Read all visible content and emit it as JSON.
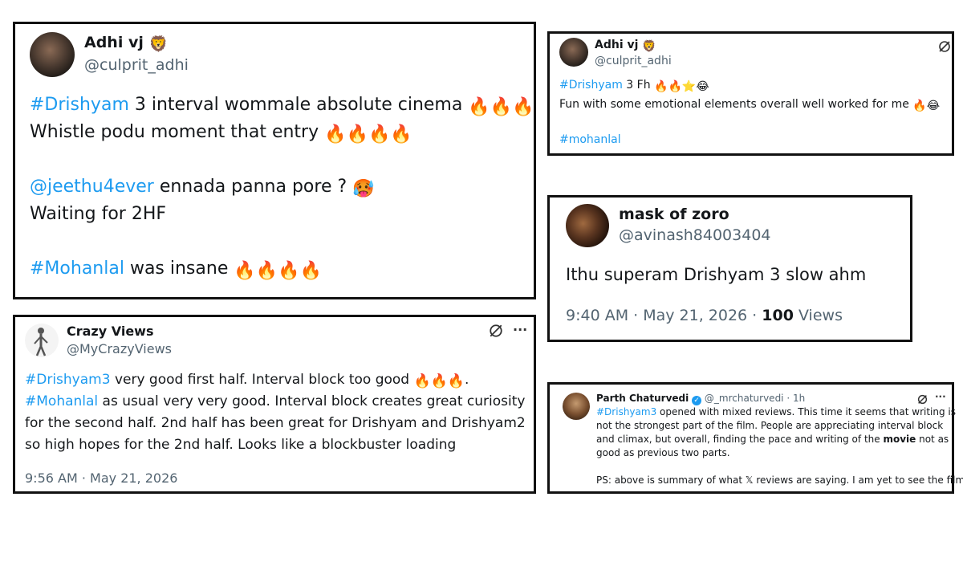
{
  "tweet1": {
    "name": "Adhi vj",
    "handle": "@culprit_adhi",
    "l1_tag": "#Drishyam",
    "l1_text": " 3 interval wommale absolute cinema ",
    "l2_text": "Whistle podu moment that entry ",
    "l3_mention": "@jeethu4ever",
    "l3_text": " ennada panna pore ? ",
    "l4_text": "Waiting for 2HF",
    "l5_tag": "#Mohanlal",
    "l5_text": " was insane "
  },
  "tweet2": {
    "name": "Adhi vj",
    "handle": "@culprit_adhi",
    "l1_tag": "#Drishyam",
    "l1_text": " 3 Fh ",
    "l2_text": "Fun with some emotional elements overall well worked for me ",
    "l3_tag": "#mohanlal"
  },
  "tweet3": {
    "name": "mask of zoro",
    "handle": "@avinash84003404",
    "body": "Ithu superam Drishyam 3 slow ahm",
    "meta": "9:40 AM · May 21, 2026 · ",
    "views_count": "100",
    "views_label": " Views"
  },
  "tweet4": {
    "name": "Crazy Views",
    "handle": "@MyCrazyViews",
    "l1_tag": "#Drishyam3",
    "l1_text": " very good first half. Interval block too good ",
    "l1_end": ".",
    "l2_tag": "#Mohanlal",
    "l2_text": " as usual very very good. Interval block creates great curiosity",
    "l3_text": "for the second half. 2nd half has been great for Drishyam and Drishyam2",
    "l4_text": "so high hopes for the 2nd half. Looks like a blockbuster loading",
    "meta": "9:56 AM · May 21, 2026",
    "more": "···"
  },
  "tweet5": {
    "name": "Parth Chaturvedi",
    "handle": "@_mrchaturvedi · 1h",
    "l1_tag": "#Drishyam3",
    "l1_text": " opened with mixed reviews. This time it seems that writing is",
    "l2_text": "not the strongest part of the film. People are appreciating interval block",
    "l3_text": "and climax, but overall, finding the pace and writing of the ",
    "l3_bold": "movie",
    "l3_end": " not as",
    "l4_text": "good as previous two parts.",
    "l5_text": "PS: above is summary of what 𝕏 reviews are saying. I am yet to see the film.",
    "more": "···"
  },
  "icons": {
    "fire": "🔥",
    "star": "⭐",
    "laugh": "😂",
    "hot_face": "🥵",
    "lion": "🦁"
  },
  "colors": {
    "hashtag": "#1d9bf0",
    "muted": "#536471",
    "border": "#111111"
  }
}
